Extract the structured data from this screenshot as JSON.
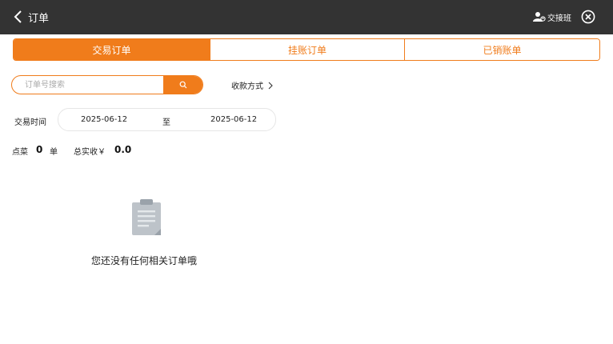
{
  "header": {
    "title": "订单",
    "handover_label": "交接班"
  },
  "tabs": [
    {
      "label": "交易订单",
      "active": true
    },
    {
      "label": "挂账订单",
      "active": false
    },
    {
      "label": "已销账单",
      "active": false
    }
  ],
  "search": {
    "placeholder": "订单号搜索",
    "value": ""
  },
  "payment_method_label": "收款方式",
  "date_filter": {
    "label": "交易时间",
    "start": "2025-06-12",
    "separator": "至",
    "end": "2025-06-12"
  },
  "summary": {
    "orders_label": "点菜",
    "orders_count": "0",
    "orders_unit": "单",
    "total_label": "总实收￥",
    "total_value": "0.0"
  },
  "empty_state": {
    "message": "您还没有任何相关订单哦"
  },
  "colors": {
    "accent": "#f07c1b",
    "topbar": "#333333"
  }
}
